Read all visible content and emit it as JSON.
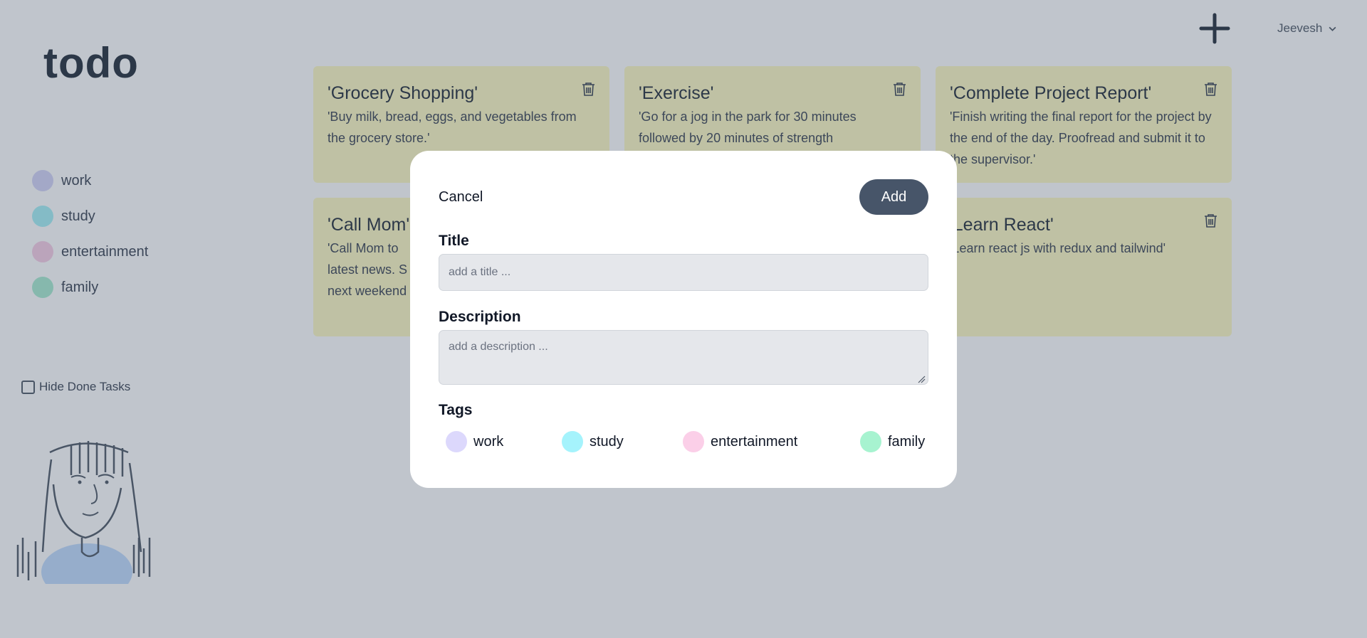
{
  "app": {
    "logo": "todo",
    "user": "Jeevesh"
  },
  "sidebar": {
    "tags": [
      {
        "label": "work",
        "color": "#d4d4f7"
      },
      {
        "label": "study",
        "color": "#a5f0f6"
      },
      {
        "label": "entertainment",
        "color": "#f7cde6"
      },
      {
        "label": "family",
        "color": "#a8ecd0"
      }
    ],
    "hide_done_label": "Hide Done Tasks"
  },
  "cards": [
    {
      "title": "'Grocery Shopping'",
      "description": "'Buy milk, bread, eggs, and vegetables from the grocery store.'"
    },
    {
      "title": "'Exercise'",
      "description": "'Go for a jog in the park for 30 minutes followed by 20 minutes of strength"
    },
    {
      "title": "'Complete Project Report'",
      "description": "'Finish writing the final report for the project by the end of the day. Proofread and submit it to the supervisor.'"
    },
    {
      "title": "'Call Mom'",
      "description": "'Call Mom to latest news. S next weekend"
    },
    {
      "title": "'Learn React'",
      "description": "'Learn react js with redux and tailwind'"
    }
  ],
  "modal": {
    "cancel_label": "Cancel",
    "add_label": "Add",
    "title_label": "Title",
    "title_placeholder": "add a title ...",
    "description_label": "Description",
    "description_placeholder": "add a description ...",
    "tags_label": "Tags",
    "tags": [
      {
        "label": "work",
        "color": "#dcd8fc"
      },
      {
        "label": "study",
        "color": "#a5f3fc"
      },
      {
        "label": "entertainment",
        "color": "#fbcfe8"
      },
      {
        "label": "family",
        "color": "#a7f3d0"
      }
    ]
  },
  "colors": {
    "card_bg": "#fef9c3",
    "overlay": "#475569",
    "add_button": "#475569"
  }
}
